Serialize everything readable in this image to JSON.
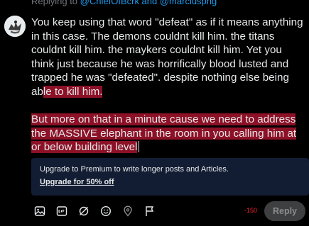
{
  "reply_header": {
    "prefix": "Replying to",
    "handles": "@ChiefOfBcrk and @marciuspng"
  },
  "composer": {
    "para1_plain": "You keep using that word \"defeat\" as if it means anything in this case. The demons couldnt kill him. the titans couldnt kill him. the maykers couldnt kill him. Yet you think just because he was horrifically blood lusted and trapped he was \"defeated\". despite nothing else being ab",
    "para1_overflow": "le to kill him.",
    "para2_overflow": "But more on that in a minute cause we need to address the MASSIVE elephant in the room in you calling him at or below building level"
  },
  "premium_banner": {
    "text": "Upgrade to Premium to write longer posts and Articles.",
    "link": "Upgrade for 50% off"
  },
  "toolbar": {
    "icons": [
      "image-icon",
      "gif-icon",
      "grok-icon",
      "emoji-icon",
      "location-icon",
      "flag-icon"
    ]
  },
  "char_counter": "-150",
  "reply_button": "Reply",
  "colors": {
    "highlight": "#8c1127",
    "accent_blue": "#1d9bf0",
    "counter_red": "#f4212e",
    "banner_bg": "#121d33"
  }
}
